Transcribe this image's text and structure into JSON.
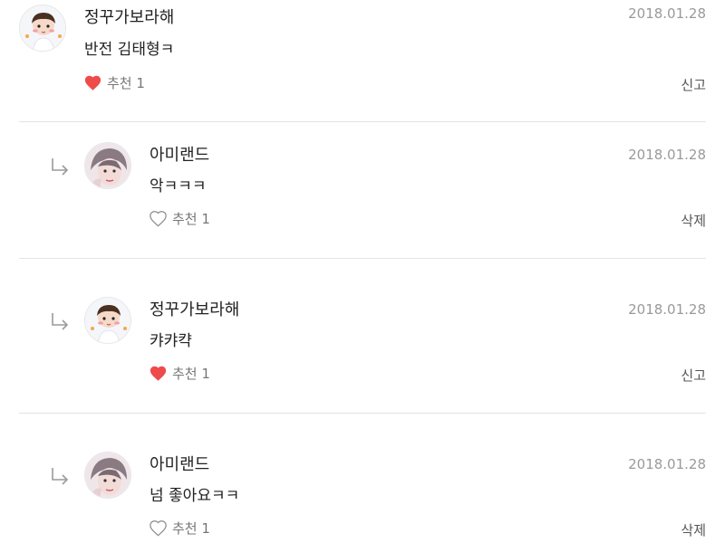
{
  "comments": [
    {
      "username": "정꾸가보라해",
      "date": "2018.01.28",
      "text": "반전 김태형ㅋ",
      "liked": true,
      "like_label": "추천 1",
      "action": "신고",
      "avatar_icon": "chibi-character-avatar-icon"
    },
    {
      "username": "아미랜드",
      "date": "2018.01.28",
      "text": "악ㅋㅋㅋ",
      "liked": false,
      "like_label": "추천 1",
      "action": "삭제",
      "avatar_icon": "profile-photo-avatar-icon"
    },
    {
      "username": "정꾸가보라해",
      "date": "2018.01.28",
      "text": "캬캬캭",
      "liked": true,
      "like_label": "추천 1",
      "action": "신고",
      "avatar_icon": "chibi-character-avatar-icon"
    },
    {
      "username": "아미랜드",
      "date": "2018.01.28",
      "text": "넘 좋아요ㅋㅋ",
      "liked": false,
      "like_label": "추천 1",
      "action": "삭제",
      "avatar_icon": "profile-photo-avatar-icon"
    }
  ],
  "colors": {
    "heart_filled": "#ef4b4b",
    "heart_outline": "#8a8a8a",
    "date": "#9a9a9a",
    "divider": "#e3e3e3"
  }
}
